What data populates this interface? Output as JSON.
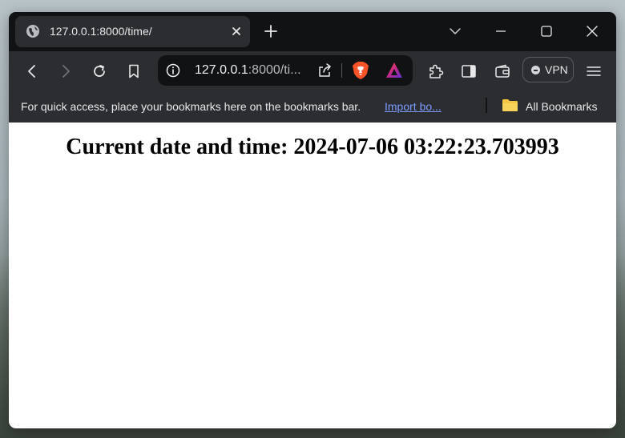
{
  "tab": {
    "title": "127.0.0.1:8000/time/"
  },
  "omnibox": {
    "url_host": "127.0.0.1",
    "url_path": ":8000/ti..."
  },
  "toolbar": {
    "vpn_label": "VPN"
  },
  "bookmarks_bar": {
    "message": "For quick access, place your bookmarks here on the bookmarks bar.",
    "import_link": "Import bo...",
    "all_bookmarks": "All Bookmarks"
  },
  "page": {
    "heading": "Current date and time: 2024-07-06 03:22:23.703993"
  },
  "colors": {
    "brave_orange": "#fb542b",
    "link_blue": "#7c9cff",
    "folder_yellow": "#f4c542"
  }
}
